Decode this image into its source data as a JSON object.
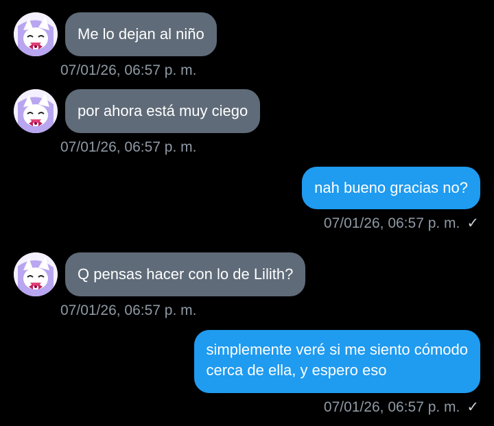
{
  "messages": [
    {
      "direction": "incoming",
      "text": "Me lo dejan al niño",
      "timestamp": "07/01/26, 06:57 p. m.",
      "avatar_icon": "avatar-icon"
    },
    {
      "direction": "incoming",
      "text": "por ahora está muy ciego",
      "timestamp": "07/01/26, 06:57 p. m.",
      "avatar_icon": "avatar-icon"
    },
    {
      "direction": "outgoing",
      "text": "nah bueno gracias no?",
      "timestamp": "07/01/26, 06:57 p. m.",
      "status_icon": "checkmark-icon"
    },
    {
      "direction": "incoming",
      "text": "Q pensas hacer con lo de Lilith?",
      "timestamp": "07/01/26, 06:57 p. m.",
      "avatar_icon": "avatar-icon"
    },
    {
      "direction": "outgoing",
      "text_lines": [
        "simplemente veré si me siento cómodo",
        "cerca de ella, y espero eso"
      ],
      "timestamp": "07/01/26, 06:57 p. m.",
      "status_icon": "checkmark-icon"
    }
  ],
  "colors": {
    "background": "#000000",
    "incoming_bubble": "#5f6b78",
    "outgoing_bubble": "#1f9bf0",
    "timestamp": "#8f9aa5",
    "text": "#ffffff"
  },
  "check_glyph": "✓"
}
